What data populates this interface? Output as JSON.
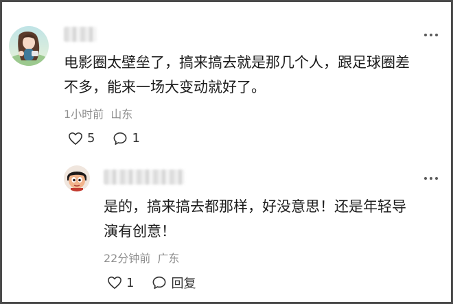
{
  "comment": {
    "text_line1": "电影圈太壁垒了，搞来搞去就是那几个人，跟足球圈差",
    "text_line2": "不多，能来一场大变动就好了。",
    "time": "1小时前",
    "location": "山东",
    "likes": "5",
    "replies": "1",
    "avatar": "user-avatar-illustrated-girl",
    "name_visible": "羊羊"
  },
  "reply": {
    "text_line1": "是的，搞来搞去都那样，好没意思！还是年轻导",
    "text_line2": "演有创意！",
    "time": "22分钟前",
    "location": "广东",
    "likes": "1",
    "reply_label": "回复",
    "avatar": "user-avatar-cartoon-boy"
  },
  "colors": {
    "text": "#1c1c1c",
    "meta": "#8f8f8f",
    "border": "#4a4a4a"
  },
  "icons": {
    "like": "heart-outline-icon",
    "comment": "speech-bubble-icon",
    "more": "more-dots-icon"
  }
}
